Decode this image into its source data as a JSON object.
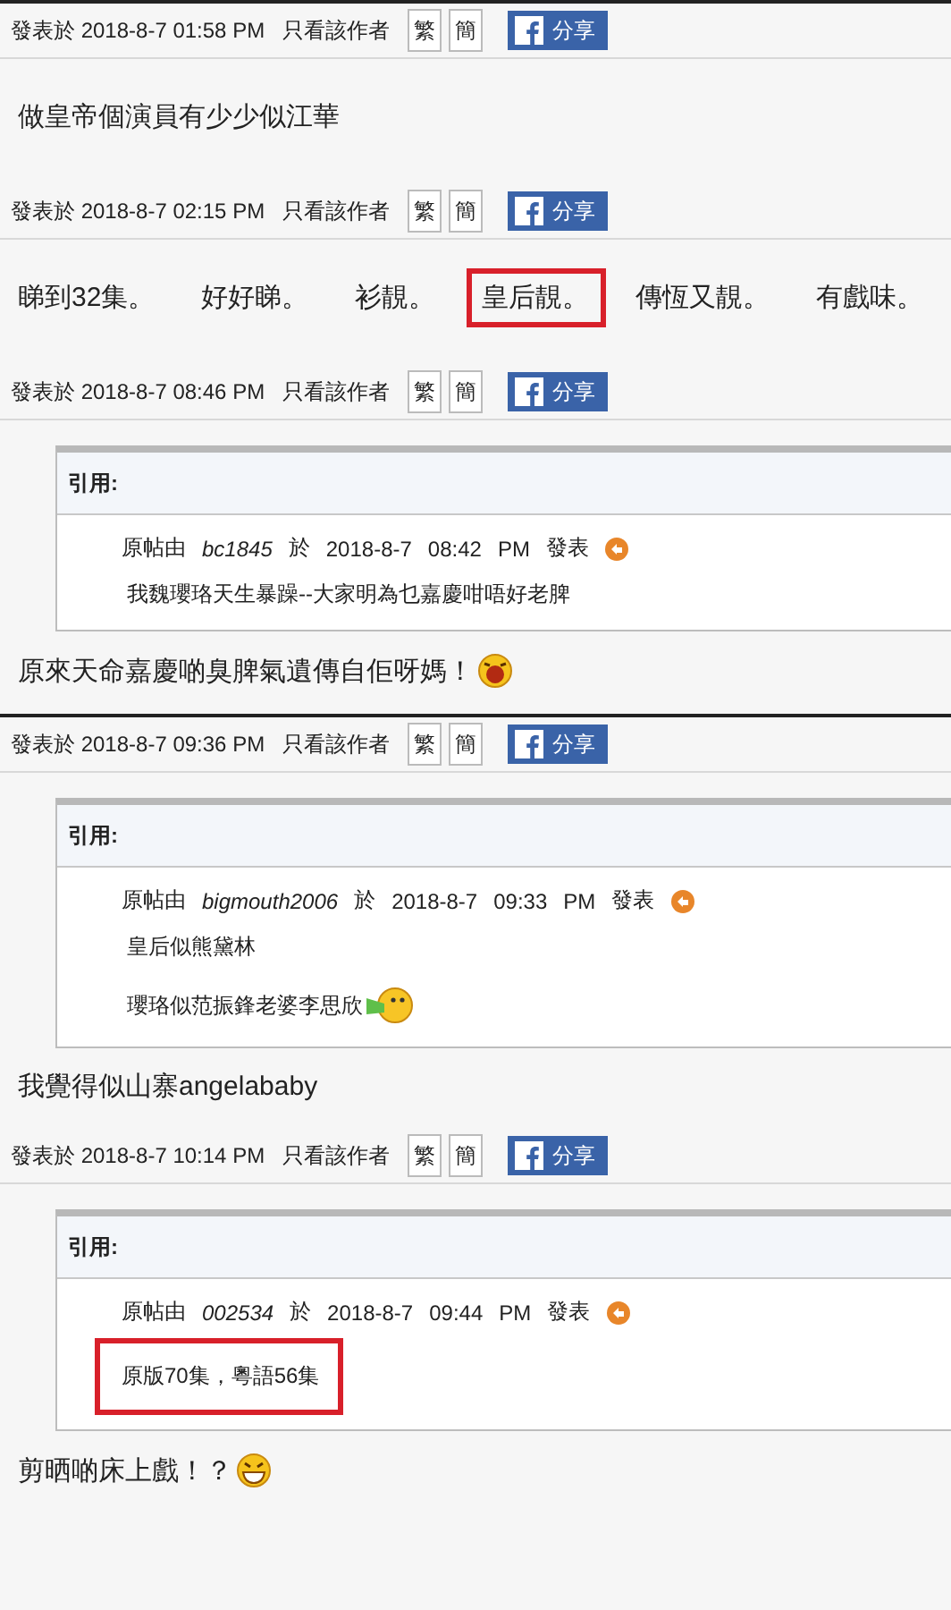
{
  "posts": [
    {
      "page_break": true,
      "meta": {
        "posted": "發表於 2018-8-7 01:58 PM",
        "author_only": "只看該作者",
        "buttons": [
          "繁",
          "簡"
        ],
        "share": "分享"
      },
      "phrases": [
        {
          "text": "做皇帝個演員有少少似江華",
          "highlighted": false
        }
      ]
    },
    {
      "page_break": false,
      "meta": {
        "posted": "發表於 2018-8-7 02:15 PM",
        "author_only": "只看該作者",
        "buttons": [
          "繁",
          "簡"
        ],
        "share": "分享"
      },
      "phrases": [
        {
          "text": "睇到32集。",
          "highlighted": false
        },
        {
          "text": "好好睇。",
          "highlighted": false
        },
        {
          "text": "衫靚。",
          "highlighted": false
        },
        {
          "text": "皇后靚。",
          "highlighted": true
        },
        {
          "text": "傳恆又靚。",
          "highlighted": false
        },
        {
          "text": "有戲味。",
          "highlighted": false
        }
      ]
    },
    {
      "page_break": false,
      "meta": {
        "posted": "發表於 2018-8-7 08:46 PM",
        "author_only": "只看該作者",
        "buttons": [
          "繁",
          "簡"
        ],
        "share": "分享"
      },
      "quote": {
        "label": "引用:",
        "by": "原帖由",
        "author": "bc1845",
        "at": "於",
        "date": "2018-8-7",
        "time": "08:42",
        "ampm": "PM",
        "posted": "發表",
        "lines": [
          {
            "text": "我魏瓔珞天生暴躁--大家明為乜嘉慶咁唔好老脾",
            "highlighted": false
          }
        ]
      },
      "reply": {
        "text": "原來天命嘉慶啲臭脾氣遺傳自佢呀媽！",
        "emoticon": {
          "kind": "laughing"
        }
      }
    },
    {
      "page_break": true,
      "meta": {
        "posted": "發表於 2018-8-7 09:36 PM",
        "author_only": "只看該作者",
        "buttons": [
          "繁",
          "簡"
        ],
        "share": "分享"
      },
      "quote": {
        "label": "引用:",
        "by": "原帖由",
        "author": "bigmouth2006",
        "at": "於",
        "date": "2018-8-7",
        "time": "09:33",
        "ampm": "PM",
        "posted": "發表",
        "lines": [
          {
            "text": "皇后似熊黛林",
            "highlighted": false
          },
          {
            "text": "瓔珞似范振鋒老婆李思欣",
            "highlighted": false,
            "emoticon": {
              "kind": "megaphone"
            }
          }
        ]
      },
      "reply": {
        "text": "我覺得似山寨angelababy"
      }
    },
    {
      "page_break": false,
      "meta": {
        "posted": "發表於 2018-8-7 10:14 PM",
        "author_only": "只看該作者",
        "buttons": [
          "繁",
          "簡"
        ],
        "share": "分享"
      },
      "quote": {
        "label": "引用:",
        "by": "原帖由",
        "author": "002534",
        "at": "於",
        "date": "2018-8-7",
        "time": "09:44",
        "ampm": "PM",
        "posted": "發表",
        "lines": [
          {
            "text": "原版70集，粵語56集",
            "highlighted": true
          }
        ]
      },
      "reply": {
        "text": "剪晒啲床上戲！？",
        "emoticon": {
          "kind": "grinning"
        }
      }
    }
  ]
}
